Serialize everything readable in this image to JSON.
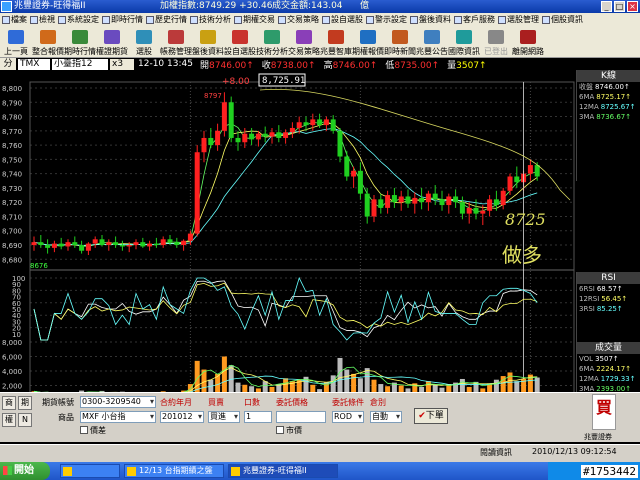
{
  "window": {
    "title": "兆豐證券-旺得福II",
    "index_text": "加權指數:8749.29 +30.46",
    "volume_text": "成交金額:143.04",
    "volume_unit": "億",
    "controls": [
      "_",
      "□",
      "×"
    ]
  },
  "menu": [
    "檔案",
    "檢視",
    "系統設定",
    "即時行情",
    "歷史行情",
    "技術分析",
    "期權交易",
    "交易策略",
    "設自選股",
    "警示設定",
    "盤後資料",
    "客戶服務",
    "選股管理",
    "個股資訊"
  ],
  "toolbar": [
    {
      "label": "上一頁",
      "color": "#2f6bd8"
    },
    {
      "label": "整合報價",
      "color": "#d06a1a"
    },
    {
      "label": "期時行情",
      "color": "#3a8a3a"
    },
    {
      "label": "權證期貨",
      "color": "#6a4bbf"
    },
    {
      "label": "選股",
      "color": "#2f8fb8"
    },
    {
      "label": "帳務管理",
      "color": "#bb3a3a"
    },
    {
      "label": "盤後資料",
      "color": "#c9a012"
    },
    {
      "label": "設自選股",
      "color": "#c9342e"
    },
    {
      "label": "技術分析",
      "color": "#2e9b6b"
    },
    {
      "label": "交易策略",
      "color": "#8a3fb8"
    },
    {
      "label": "兆豐智庫",
      "color": "#c23b1f"
    },
    {
      "label": "期權報價",
      "color": "#1f6fc2"
    },
    {
      "label": "即時新聞",
      "color": "#c25a1f"
    },
    {
      "label": "兆豐公告",
      "color": "#3f7fbf"
    },
    {
      "label": "國際資訊",
      "color": "#1f9b9b"
    },
    {
      "label": "已登出",
      "color": "#888888"
    },
    {
      "label": "離開網路",
      "color": "#aa1f1f"
    }
  ],
  "quote": {
    "tab_label": "分",
    "code": "TMX",
    "name": "小臺指12",
    "scale": "x3",
    "datetime": "12-10 13:45",
    "open_label": "開",
    "open": "8746.00↑",
    "close_label": "收",
    "close": "8738.00↑",
    "high_label": "高",
    "high": "8746.00↑",
    "low_label": "低",
    "low": "8735.00↑",
    "vol_label": "量",
    "vol": "3507↑"
  },
  "overlay": {
    "change": "+8.00",
    "price_box": "8,725.91",
    "high_mark": "8797",
    "low_mark": "8676",
    "handwriting_price": "8725",
    "handwriting_note": "做多"
  },
  "kline_panel": {
    "head": "K線",
    "rows": [
      {
        "k": "收盤",
        "v": "8746.00↑"
      },
      {
        "k": "6MA",
        "v": "8725.17↑"
      },
      {
        "k": "12MA",
        "v": "8725.67↑"
      },
      {
        "k": "3MA",
        "v": "8736.67↑"
      }
    ]
  },
  "rsi_panel": {
    "head": "RSI",
    "rows": [
      {
        "k": "6RSI",
        "v": "68.57↑"
      },
      {
        "k": "12RSI",
        "v": "56.45↑"
      },
      {
        "k": "3RSI",
        "v": "85.25↑"
      }
    ]
  },
  "vol_panel": {
    "head": "成交量",
    "rows": [
      {
        "k": "VOL",
        "v": "3507↑"
      },
      {
        "k": "6MA",
        "v": "2224.17↑"
      },
      {
        "k": "12MA",
        "v": "1729.33↑"
      },
      {
        "k": "3MA",
        "v": "2393.00↑"
      }
    ]
  },
  "axes": {
    "price_ticks": [
      "8,800",
      "8,790",
      "8,780",
      "8,770",
      "8,760",
      "8,750",
      "8,740",
      "8,730",
      "8,720",
      "8,710",
      "8,700",
      "8,690",
      "8,680"
    ],
    "rsi_ticks": [
      "100",
      "90",
      "80",
      "70",
      "60",
      "50",
      "40",
      "30",
      "20",
      "10"
    ],
    "vol_ticks": [
      "8,000",
      "6,000",
      "4,000",
      "2,000"
    ],
    "date_labels": [
      "2010",
      "12",
      "12/9",
      "12/10",
      "12/13"
    ]
  },
  "order": {
    "btn_a": "商",
    "btn_b": "期",
    "btn_c": "權",
    "btn_d": "N",
    "account_label": "期貨帳號",
    "account": "0300-3209540",
    "product_label": "商品",
    "product": "MXF 小台指",
    "month_label": "合約年月",
    "month": "201012",
    "side_label": "買賣",
    "side": "買進",
    "qty_label": "口數",
    "qty": "1",
    "price_label": "委託價格",
    "price": "",
    "cond_label": "委託條件",
    "cond": "ROD",
    "oc_label": "倉別",
    "oc": "自動",
    "market_label": "價差",
    "mkt_label": "市價",
    "submit": "下單",
    "buy": "買",
    "broker": "兆豐證券"
  },
  "status": {
    "news": "閱讀資訊",
    "date": "2010/12/13",
    "time": "09:12:54"
  },
  "taskbar": {
    "start": "開始",
    "tasks": [
      "",
      "12/13 台指期績之盤",
      "兆豐證券-旺得福II"
    ],
    "watermark": "#1753442"
  },
  "chart_data": {
    "type": "candlestick",
    "price_ylim": [
      8676,
      8800
    ],
    "x_count": 80,
    "ohlc": [
      [
        8690,
        8696,
        8686,
        8692
      ],
      [
        8692,
        8697,
        8688,
        8690
      ],
      [
        8690,
        8694,
        8684,
        8688
      ],
      [
        8688,
        8693,
        8685,
        8691
      ],
      [
        8691,
        8695,
        8687,
        8689
      ],
      [
        8689,
        8694,
        8686,
        8692
      ],
      [
        8692,
        8696,
        8688,
        8690
      ],
      [
        8690,
        8693,
        8684,
        8686
      ],
      [
        8686,
        8692,
        8683,
        8691
      ],
      [
        8691,
        8696,
        8688,
        8694
      ],
      [
        8694,
        8697,
        8689,
        8690
      ],
      [
        8690,
        8694,
        8686,
        8692
      ],
      [
        8692,
        8696,
        8688,
        8690
      ],
      [
        8690,
        8693,
        8686,
        8689
      ],
      [
        8689,
        8692,
        8685,
        8690
      ],
      [
        8690,
        8694,
        8687,
        8692
      ],
      [
        8692,
        8695,
        8688,
        8689
      ],
      [
        8689,
        8693,
        8686,
        8691
      ],
      [
        8691,
        8695,
        8688,
        8690
      ],
      [
        8690,
        8696,
        8688,
        8694
      ],
      [
        8694,
        8697,
        8690,
        8692
      ],
      [
        8692,
        8695,
        8688,
        8690
      ],
      [
        8690,
        8694,
        8686,
        8693
      ],
      [
        8693,
        8700,
        8690,
        8698
      ],
      [
        8698,
        8760,
        8696,
        8755
      ],
      [
        8755,
        8770,
        8748,
        8765
      ],
      [
        8765,
        8772,
        8758,
        8760
      ],
      [
        8760,
        8775,
        8756,
        8770
      ],
      [
        8770,
        8797,
        8766,
        8790
      ],
      [
        8790,
        8794,
        8762,
        8765
      ],
      [
        8765,
        8770,
        8756,
        8762
      ],
      [
        8762,
        8772,
        8758,
        8768
      ],
      [
        8768,
        8772,
        8760,
        8764
      ],
      [
        8764,
        8770,
        8759,
        8768
      ],
      [
        8768,
        8773,
        8762,
        8766
      ],
      [
        8766,
        8772,
        8761,
        8769
      ],
      [
        8769,
        8774,
        8762,
        8765
      ],
      [
        8765,
        8771,
        8761,
        8769
      ],
      [
        8769,
        8776,
        8765,
        8772
      ],
      [
        8772,
        8780,
        8768,
        8776
      ],
      [
        8776,
        8780,
        8770,
        8774
      ],
      [
        8774,
        8782,
        8770,
        8778
      ],
      [
        8778,
        8782,
        8772,
        8774
      ],
      [
        8774,
        8780,
        8770,
        8778
      ],
      [
        8778,
        8781,
        8768,
        8770
      ],
      [
        8770,
        8772,
        8748,
        8752
      ],
      [
        8752,
        8756,
        8735,
        8738
      ],
      [
        8738,
        8745,
        8730,
        8742
      ],
      [
        8742,
        8748,
        8722,
        8726
      ],
      [
        8726,
        8730,
        8705,
        8710
      ],
      [
        8710,
        8725,
        8706,
        8722
      ],
      [
        8722,
        8726,
        8712,
        8716
      ],
      [
        8716,
        8728,
        8712,
        8725
      ],
      [
        8725,
        8730,
        8716,
        8720
      ],
      [
        8720,
        8728,
        8714,
        8724
      ],
      [
        8724,
        8729,
        8716,
        8719
      ],
      [
        8719,
        8727,
        8712,
        8723
      ],
      [
        8723,
        8730,
        8715,
        8720
      ],
      [
        8720,
        8728,
        8714,
        8726
      ],
      [
        8726,
        8732,
        8718,
        8722
      ],
      [
        8722,
        8728,
        8714,
        8718
      ],
      [
        8718,
        8726,
        8712,
        8724
      ],
      [
        8724,
        8729,
        8716,
        8720
      ],
      [
        8720,
        8724,
        8708,
        8712
      ],
      [
        8712,
        8720,
        8705,
        8716
      ],
      [
        8716,
        8722,
        8708,
        8712
      ],
      [
        8712,
        8718,
        8704,
        8714
      ],
      [
        8714,
        8725,
        8710,
        8722
      ],
      [
        8722,
        8728,
        8714,
        8718
      ],
      [
        8718,
        8730,
        8715,
        8728
      ],
      [
        8728,
        8740,
        8725,
        8738
      ],
      [
        8738,
        8745,
        8730,
        8734
      ],
      [
        8734,
        8742,
        8728,
        8740
      ],
      [
        8740,
        8750,
        8735,
        8746
      ],
      [
        8746,
        8748,
        8735,
        8738
      ]
    ],
    "volume": [
      1200,
      900,
      1100,
      800,
      1000,
      700,
      950,
      1300,
      1100,
      900,
      1250,
      800,
      1000,
      1150,
      700,
      900,
      1050,
      850,
      950,
      1200,
      1000,
      900,
      1300,
      2200,
      5400,
      4200,
      2800,
      3600,
      6000,
      4800,
      2400,
      2100,
      1900,
      1600,
      2600,
      1800,
      2200,
      3000,
      2600,
      2800,
      3200,
      2100,
      1500,
      2500,
      3400,
      5800,
      4200,
      3600,
      3000,
      4400,
      2800,
      2200,
      1900,
      2400,
      2000,
      1600,
      2300,
      1800,
      2600,
      2100,
      1700,
      2200,
      2400,
      2900,
      1800,
      2500,
      1600,
      2300,
      2800,
      3300,
      3800,
      2600,
      2900,
      3507,
      3100
    ],
    "vol_ylim": [
      0,
      8000
    ],
    "rsi_ylim": [
      0,
      100
    ]
  }
}
